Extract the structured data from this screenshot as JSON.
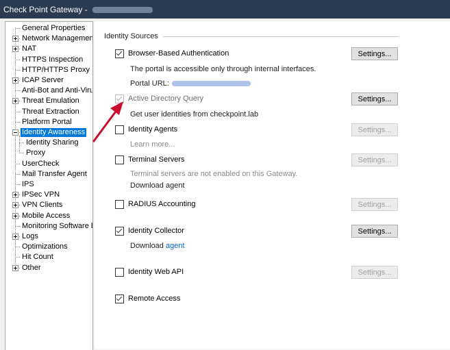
{
  "window": {
    "title": "Check Point Gateway - "
  },
  "tree": {
    "items": [
      {
        "label": "General Properties",
        "expandable": false
      },
      {
        "label": "Network Management",
        "expandable": true
      },
      {
        "label": "NAT",
        "expandable": true
      },
      {
        "label": "HTTPS Inspection",
        "expandable": false
      },
      {
        "label": "HTTP/HTTPS Proxy",
        "expandable": false
      },
      {
        "label": "ICAP Server",
        "expandable": true
      },
      {
        "label": "Anti-Bot and Anti-Virus",
        "expandable": false
      },
      {
        "label": "Threat Emulation",
        "expandable": true
      },
      {
        "label": "Threat Extraction",
        "expandable": false
      },
      {
        "label": "Platform Portal",
        "expandable": false
      },
      {
        "label": "Identity Awareness",
        "expandable": true,
        "selected": true
      },
      {
        "label": "Identity Sharing",
        "expandable": false,
        "child": true
      },
      {
        "label": "Proxy",
        "expandable": false,
        "child": true
      },
      {
        "label": "UserCheck",
        "expandable": false
      },
      {
        "label": "Mail Transfer Agent",
        "expandable": false
      },
      {
        "label": "IPS",
        "expandable": false
      },
      {
        "label": "IPSec VPN",
        "expandable": true
      },
      {
        "label": "VPN Clients",
        "expandable": true
      },
      {
        "label": "Mobile Access",
        "expandable": true
      },
      {
        "label": "Monitoring Software bla",
        "expandable": false
      },
      {
        "label": "Logs",
        "expandable": true
      },
      {
        "label": "Optimizations",
        "expandable": false
      },
      {
        "label": "Hit Count",
        "expandable": false
      },
      {
        "label": "Other",
        "expandable": true
      }
    ]
  },
  "identity_sources": {
    "title": "Identity Sources",
    "browser_auth": {
      "label": "Browser-Based Authentication",
      "checked": true,
      "button": "Settings...",
      "desc": "The portal is accessible only through internal interfaces.",
      "portal_label": "Portal URL:"
    },
    "ad_query": {
      "label": "Active Directory Query",
      "checked": true,
      "disabled": true,
      "button": "Settings...",
      "desc": "Get user identities from checkpoint.lab"
    },
    "identity_agents": {
      "label": "Identity Agents",
      "checked": false,
      "button": "Settings...",
      "desc": "Learn more..."
    },
    "terminal_servers": {
      "label": "Terminal Servers",
      "checked": false,
      "button": "Settings...",
      "desc": "Terminal servers are not enabled on this Gateway.",
      "download": "Download agent"
    },
    "radius": {
      "label": "RADIUS Accounting",
      "checked": false,
      "button": "Settings..."
    },
    "identity_collector": {
      "label": "Identity Collector",
      "checked": true,
      "button": "Settings...",
      "download_prefix": "Download",
      "download_link": "agent"
    },
    "web_api": {
      "label": "Identity Web API",
      "checked": false,
      "button": "Settings..."
    },
    "remote_access": {
      "label": "Remote Access",
      "checked": true
    }
  },
  "colors": {
    "titlebar": "#2b3a4f",
    "selection": "#0078d7",
    "arrow": "#c8102e",
    "link": "#0066cc"
  }
}
